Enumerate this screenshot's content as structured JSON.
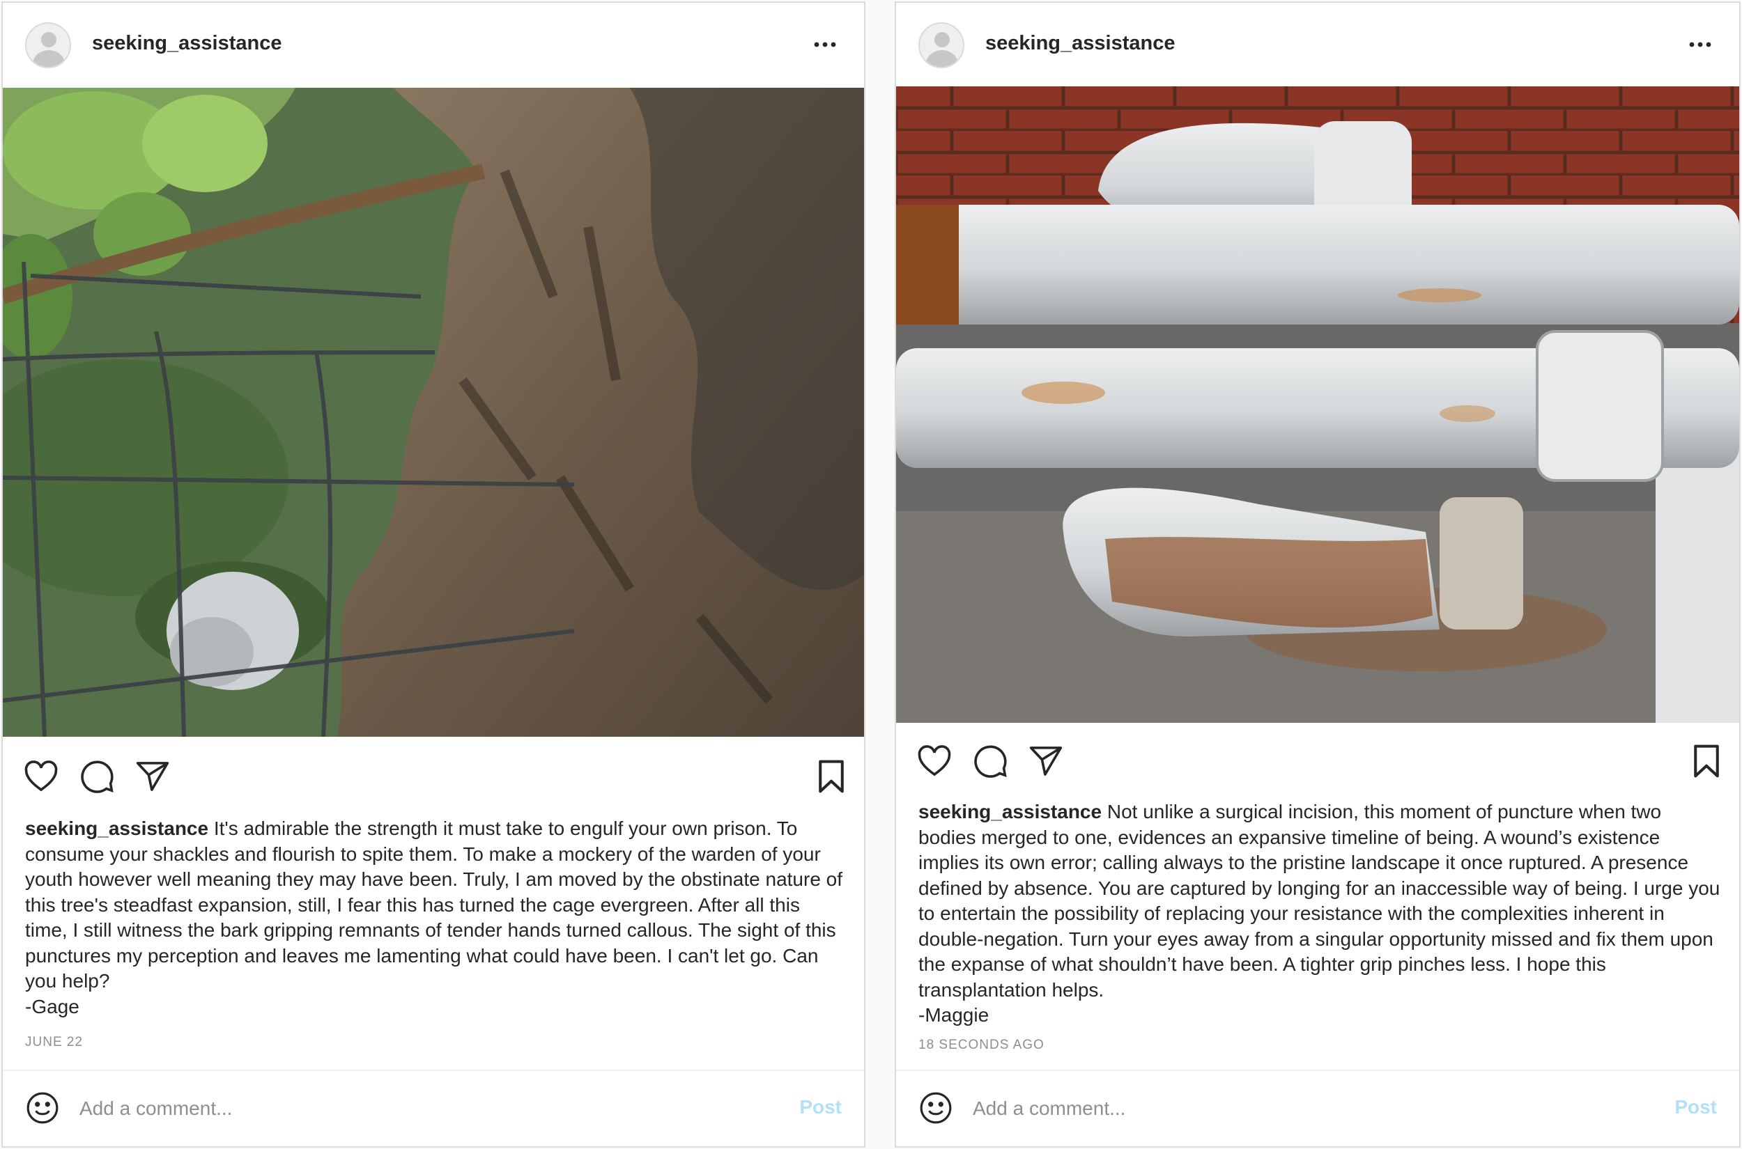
{
  "colors": {
    "accent": "#0095f6",
    "accent_disabled": "#b2dffc",
    "text": "#262626",
    "muted": "#8e8e8e",
    "border": "#dbdbdb"
  },
  "posts": [
    {
      "username": "seeking_assistance",
      "photo": "Tree trunk with bark grown around a rusted wire fence, green leaves at top-left, dappled sunlight",
      "caption_user": "seeking_assistance",
      "caption_text": "It's admirable the strength it must take to engulf your own prison. To consume your shackles and flourish to spite them. To make a mockery of the warden of your youth however well meaning they may have been. Truly, I am moved by the obstinate nature of this tree's steadfast expansion, still, I fear this has turned the cage evergreen. After all this time, I still witness the bark gripping remnants of tender hands turned callous. The sight of this punctures my perception and leaves me lamenting what could have been. I can't let go. Can you help?",
      "signature": "-Gage",
      "timestamp": "JUNE 22",
      "comment_placeholder": "Add a comment...",
      "post_label": "Post",
      "icons": [
        "avatar-icon",
        "more-options-icon",
        "heart-icon",
        "comment-icon",
        "share-icon",
        "bookmark-icon",
        "emoji-icon"
      ]
    },
    {
      "username": "seeking_assistance",
      "photo": "Rusted white-painted pipes with clamps against a brick wall and concrete ground",
      "caption_user": "seeking_assistance",
      "caption_text": "Not unlike a surgical incision, this moment of puncture when two bodies merged to one, evidences an expansive timeline of being. A wound’s existence implies its own error; calling always to the pristine landscape it once ruptured. A presence defined by absence. You are captured by longing for an inaccessible way of being. I urge you to entertain the possibility of replacing your resistance with the complexities inherent in double-negation. Turn your eyes away from a singular opportunity missed and fix them upon the expanse of what shouldn’t have been. A tighter grip pinches less. I hope this transplantation helps.",
      "signature": "-Maggie",
      "timestamp": "18 SECONDS AGO",
      "comment_placeholder": "Add a comment...",
      "post_label": "Post",
      "icons": [
        "avatar-icon",
        "more-options-icon",
        "heart-icon",
        "comment-icon",
        "share-icon",
        "bookmark-icon",
        "emoji-icon"
      ]
    }
  ]
}
